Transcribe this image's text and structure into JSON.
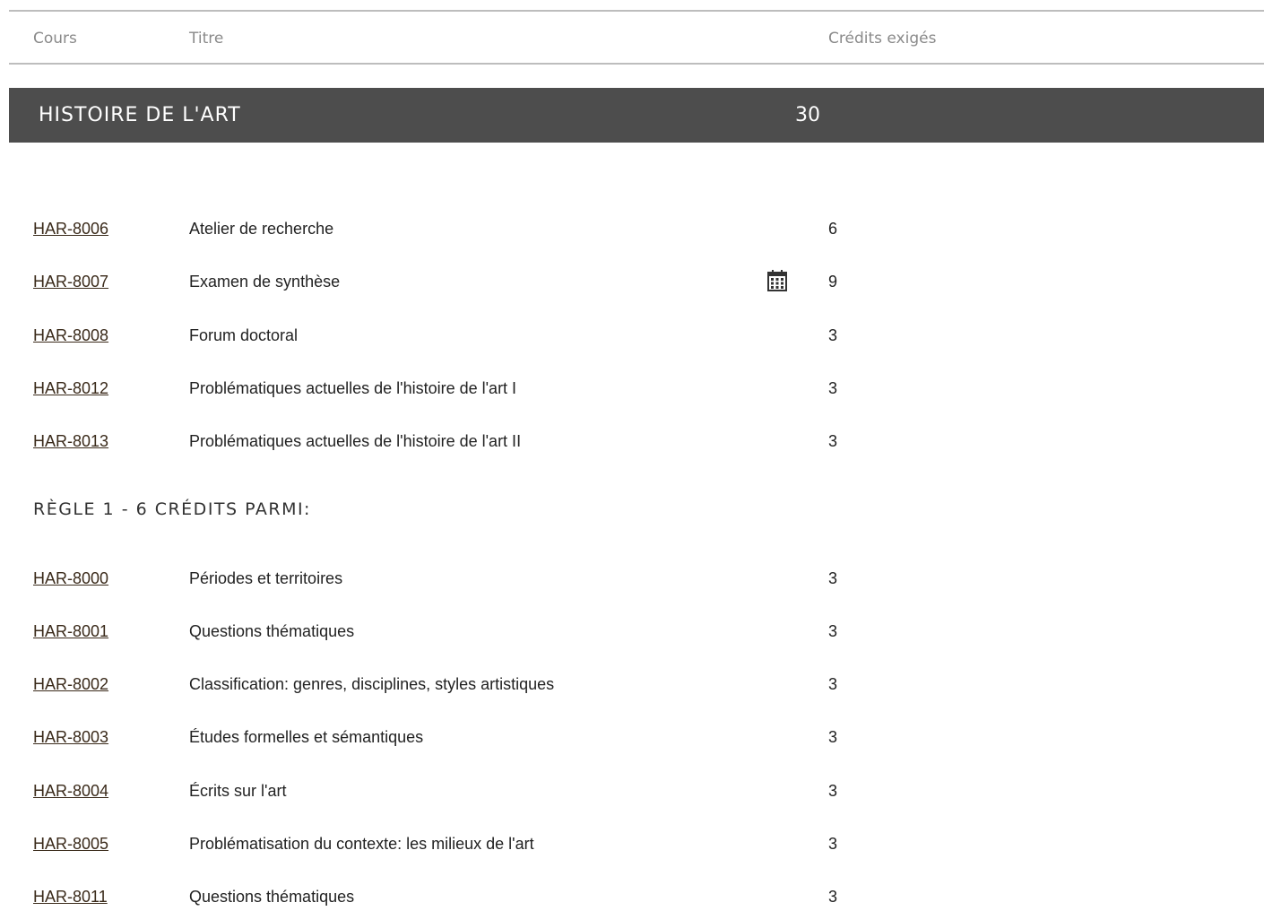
{
  "header": {
    "cours": "Cours",
    "titre": "Titre",
    "credits": "Crédits exigés"
  },
  "section": {
    "title": "HISTOIRE DE L'ART",
    "credits": "30"
  },
  "required_courses": [
    {
      "code": "HAR-8006",
      "title": "Atelier de recherche",
      "credits": "6"
    },
    {
      "code": "HAR-8007",
      "title": "Examen de synthèse",
      "credits": "9",
      "icon": "calendar-icon"
    },
    {
      "code": "HAR-8008",
      "title": "Forum doctoral",
      "credits": "3"
    },
    {
      "code": "HAR-8012",
      "title": "Problématiques actuelles de l'histoire de l'art I",
      "credits": "3"
    },
    {
      "code": "HAR-8013",
      "title": "Problématiques actuelles de l'histoire de l'art II",
      "credits": "3"
    }
  ],
  "rule": {
    "title": "RÈGLE 1 - 6 CRÉDITS PARMI:",
    "courses": [
      {
        "code": "HAR-8000",
        "title": "Périodes et territoires",
        "credits": "3"
      },
      {
        "code": "HAR-8001",
        "title": "Questions thématiques",
        "credits": "3"
      },
      {
        "code": "HAR-8002",
        "title": "Classification: genres, disciplines, styles artistiques",
        "credits": "3"
      },
      {
        "code": "HAR-8003",
        "title": "Études formelles et sémantiques",
        "credits": "3"
      },
      {
        "code": "HAR-8004",
        "title": "Écrits sur l'art",
        "credits": "3"
      },
      {
        "code": "HAR-8005",
        "title": "Problématisation du contexte: les milieux de l'art",
        "credits": "3"
      },
      {
        "code": "HAR-8011",
        "title": "Questions thématiques",
        "credits": "3"
      }
    ]
  },
  "colors": {
    "section_bar": "#4d4d4d",
    "link": "#3a2a1a",
    "header_text": "#8a8a8a"
  }
}
